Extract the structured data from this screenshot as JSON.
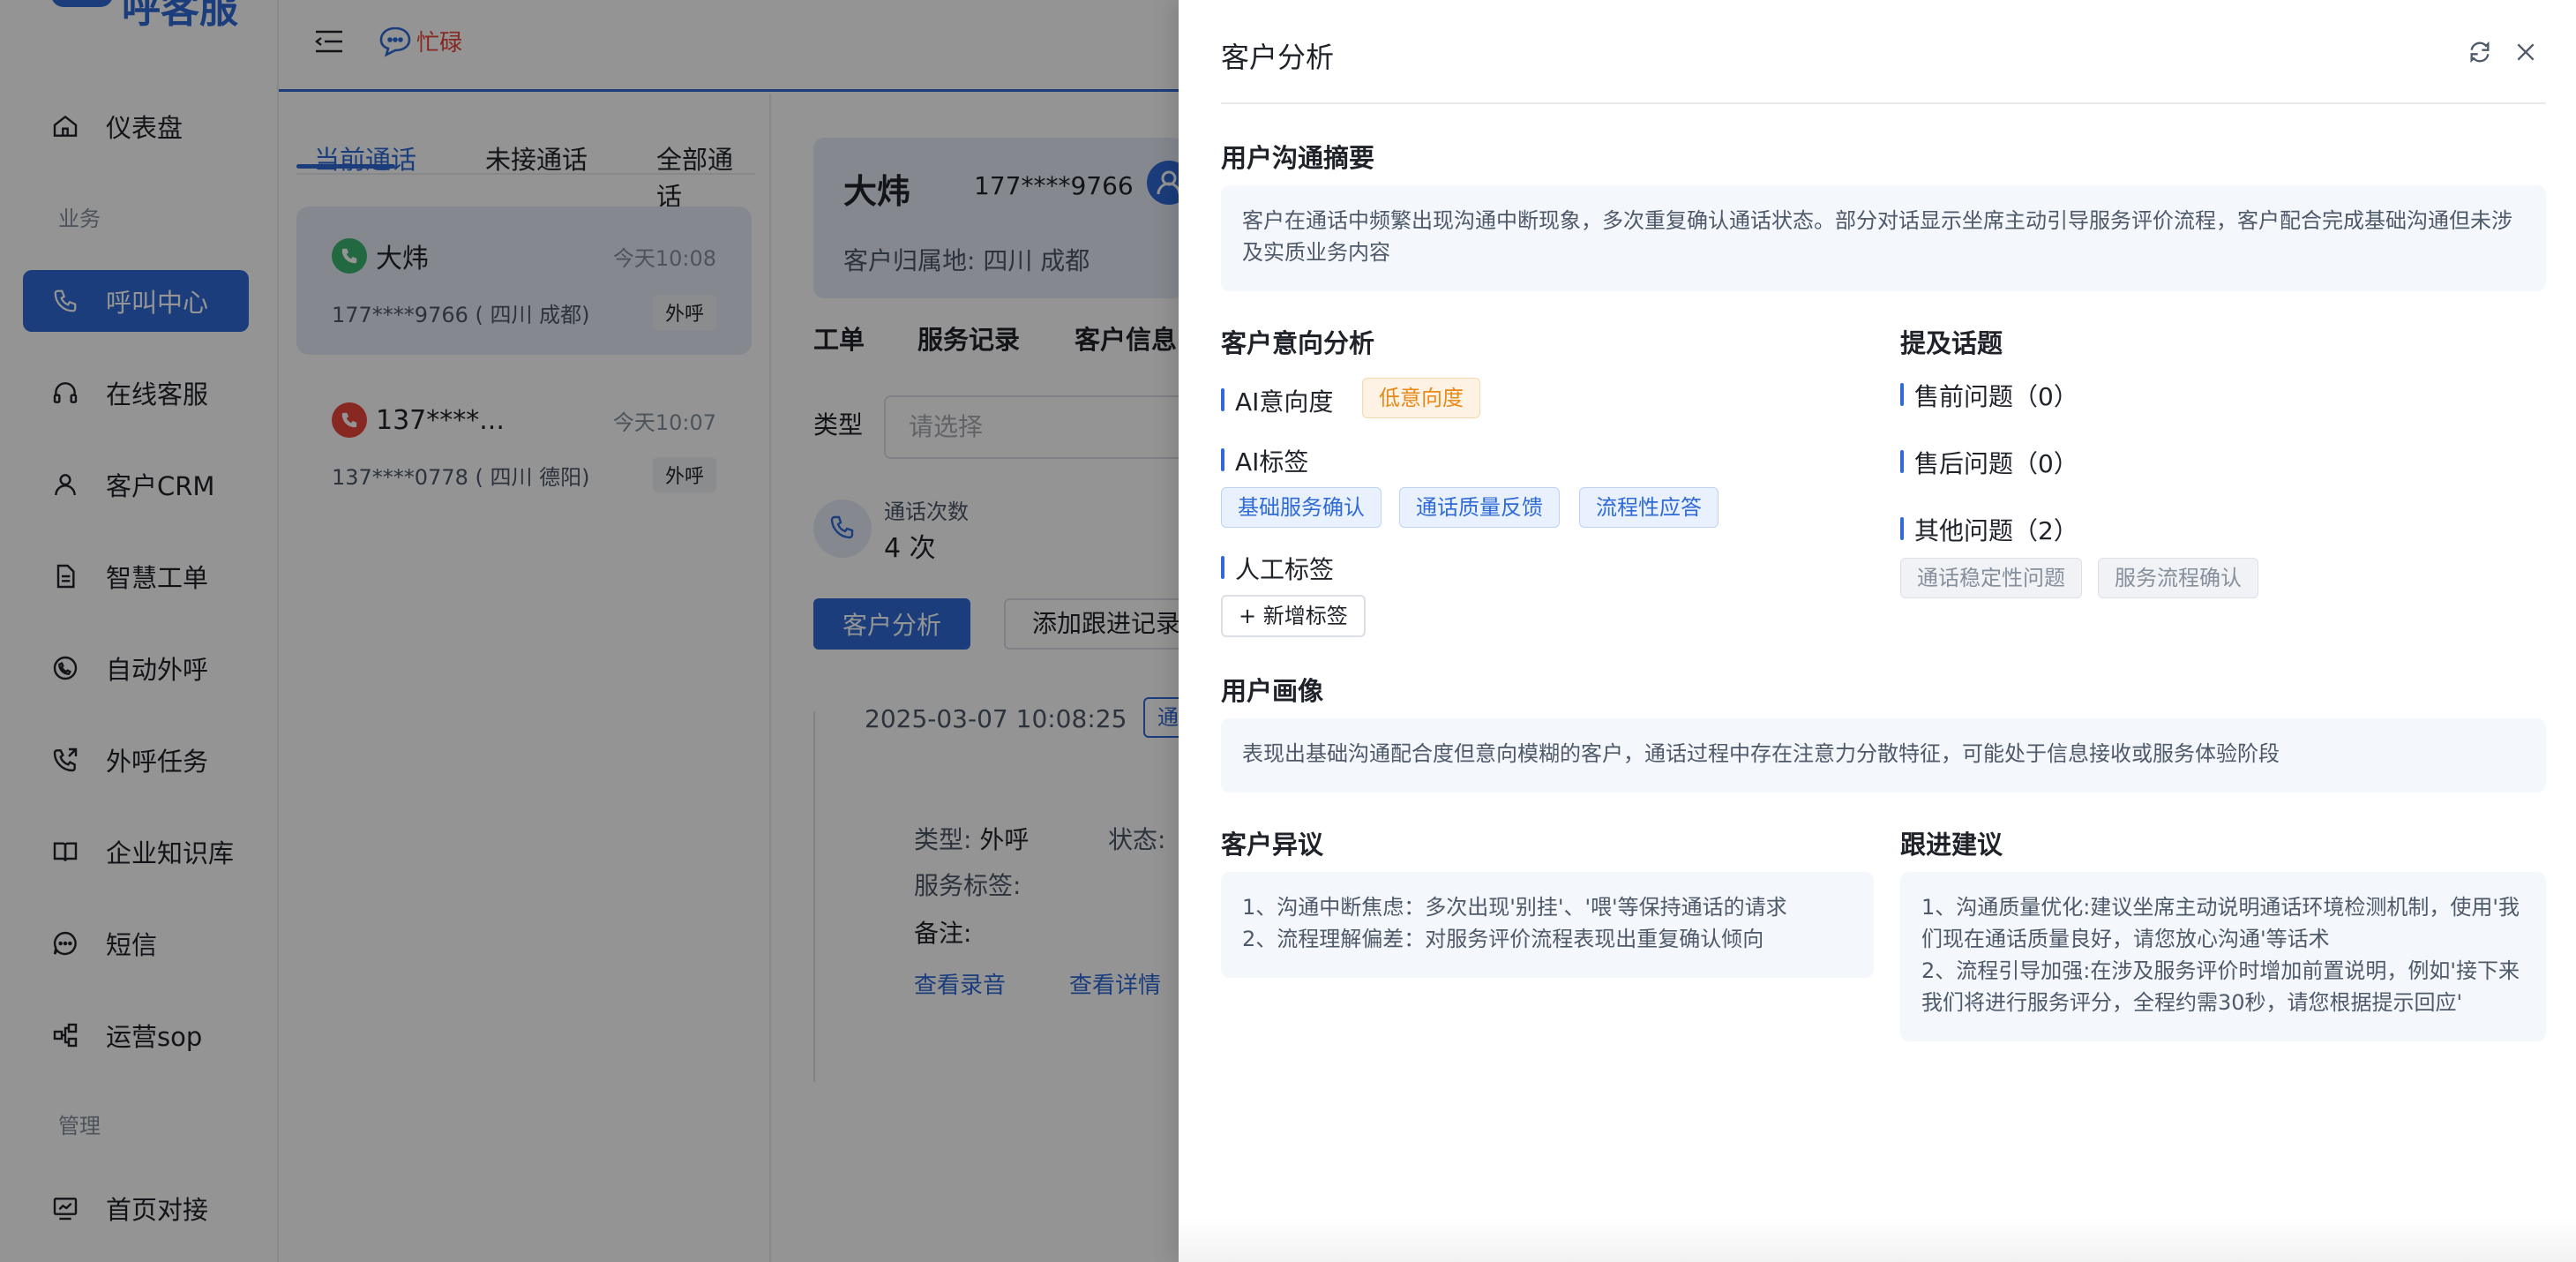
{
  "sidebar": {
    "logo_text": "呼客服",
    "group_business": "业务",
    "group_manage": "管理",
    "items": [
      {
        "label": "仪表盘",
        "icon": "home-icon"
      },
      {
        "label": "呼叫中心",
        "icon": "phone-icon",
        "active": true
      },
      {
        "label": "在线客服",
        "icon": "headset-icon"
      },
      {
        "label": "客户CRM",
        "icon": "user-icon"
      },
      {
        "label": "智慧工单",
        "icon": "document-icon"
      },
      {
        "label": "自动外呼",
        "icon": "whatsapp-phone-icon"
      },
      {
        "label": "外呼任务",
        "icon": "phone-outgoing-icon"
      },
      {
        "label": "企业知识库",
        "icon": "book-icon"
      },
      {
        "label": "短信",
        "icon": "sms-icon"
      },
      {
        "label": "运营sop",
        "icon": "flow-icon"
      },
      {
        "label": "首页对接",
        "icon": "chart-icon"
      }
    ]
  },
  "topbar": {
    "status_label": "忙碌"
  },
  "calls": {
    "tabs": [
      "当前通话",
      "未接通话",
      "全部通话"
    ],
    "items": [
      {
        "name": "大炜",
        "time": "今天10:08",
        "detail": "177****9766 ( 四川 成都)",
        "direction": "外呼",
        "status_color": "#3cb371"
      },
      {
        "name": "137****...",
        "time": "今天10:07",
        "detail": "137****0778 ( 四川 德阳)",
        "direction": "外呼",
        "status_color": "#e8453c"
      }
    ]
  },
  "detail": {
    "customer_name": "大炜",
    "customer_phone": "177****9766",
    "location": "客户归属地:  四川 成都",
    "tabs": [
      "工单",
      "服务记录",
      "客户信息"
    ],
    "type_label": "类型",
    "type_placeholder": "请选择",
    "call_count_label": "通话次数",
    "call_count_value": "4 次",
    "btn_analysis": "客户分析",
    "btn_follow": "添加跟进记录",
    "record_time": "2025-03-07 10:08:25",
    "record_badge": "通",
    "record_type_label": "类型:",
    "record_type_value": "外呼",
    "record_status_label": "状态:",
    "record_service_tags": "服务标签:",
    "record_note": "备注:",
    "link_recording": "查看录音",
    "link_details": "查看详情"
  },
  "drawer": {
    "title": "客户分析",
    "summary_title": "用户沟通摘要",
    "summary_text": "客户在通话中频繁出现沟通中断现象，多次重复确认通话状态。部分对话显示坐席主动引导服务评价流程，客户配合完成基础沟通但未涉及实质业务内容",
    "intent_title": "客户意向分析",
    "ai_intent_label": "AI意向度",
    "ai_intent_value": "低意向度",
    "ai_tags_label": "AI标签",
    "ai_tags": [
      "基础服务确认",
      "通话质量反馈",
      "流程性应答"
    ],
    "manual_tags_label": "人工标签",
    "add_tag_label": "+ 新增标签",
    "topics_title": "提及话题",
    "topic_presale": "售前问题（0）",
    "topic_aftersale": "售后问题（0）",
    "topic_other": "其他问题（2）",
    "other_tags": [
      "通话稳定性问题",
      "服务流程确认"
    ],
    "portrait_title": "用户画像",
    "portrait_text": "表现出基础沟通配合度但意向模糊的客户，通话过程中存在注意力分散特征，可能处于信息接收或服务体验阶段",
    "objection_title": "客户异议",
    "objection_lines": [
      "1、沟通中断焦虑：多次出现'别挂'、'喂'等保持通话的请求",
      "2、流程理解偏差：对服务评价流程表现出重复确认倾向"
    ],
    "advice_title": "跟进建议",
    "advice_lines": [
      "1、沟通质量优化:建议坐席主动说明通话环境检测机制，使用'我们现在通话质量良好，请您放心沟通'等话术",
      "2、流程引导加强:在涉及服务评价时增加前置说明，例如'接下来我们将进行服务评分，全程约需30秒，请您根据提示回应'"
    ]
  }
}
